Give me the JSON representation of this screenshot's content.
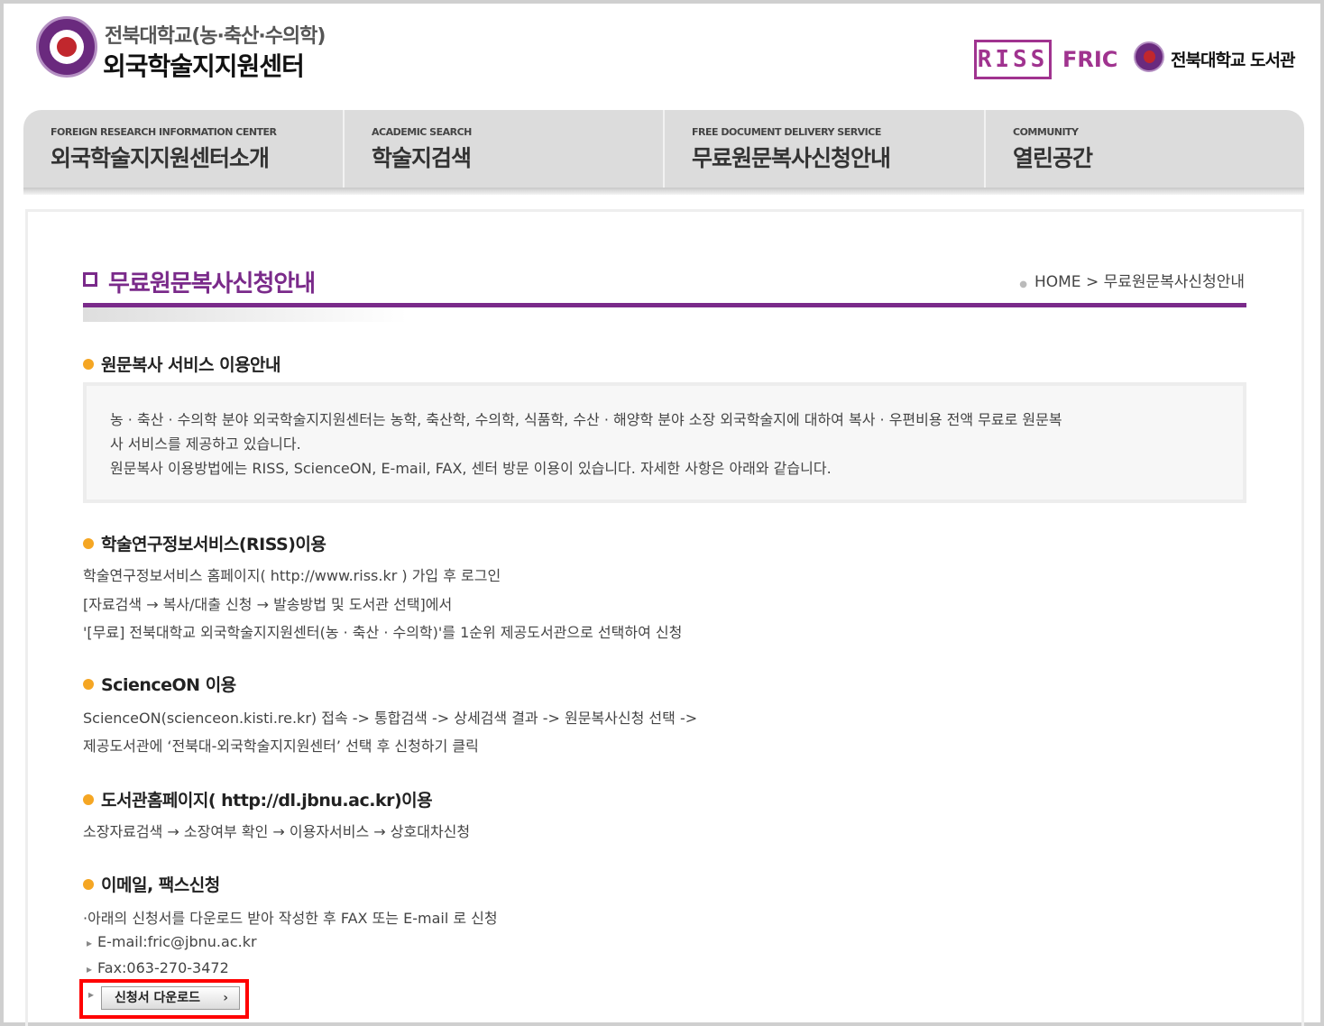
{
  "header": {
    "subtitle": "전북대학교(농·축산·수의학)",
    "title": "외국학술지지원센터",
    "riss_logo": "RISS",
    "fric": "FRIC",
    "library": "전북대학교 도서관"
  },
  "nav": [
    {
      "en": "FOREIGN RESEARCH INFORMATION CENTER",
      "ko": "외국학술지지원센터소개"
    },
    {
      "en": "ACADEMIC SEARCH",
      "ko": "학술지검색"
    },
    {
      "en": "FREE DOCUMENT DELIVERY SERVICE",
      "ko": "무료원문복사신청안내"
    },
    {
      "en": "COMMUNITY",
      "ko": "열린공간"
    }
  ],
  "page": {
    "title": "무료원문복사신청안내",
    "breadcrumb_home": "HOME",
    "breadcrumb_sep": ">",
    "breadcrumb_current": "무료원문복사신청안내"
  },
  "sections": {
    "intro": {
      "title": "원문복사 서비스 이용안내",
      "line1": "농 · 축산 · 수의학 분야 외국학술지지원센터는 농학, 축산학, 수의학, 식품학, 수산 · 해양학 분야 소장 외국학술지에 대하여 복사 · 우편비용 전액 무료로 원문복",
      "line2": "사 서비스를 제공하고 있습니다.",
      "line3": "원문복사 이용방법에는 RISS, ScienceON, E-mail, FAX, 센터 방문 이용이 있습니다. 자세한 사항은 아래와 같습니다."
    },
    "riss": {
      "title": "학술연구정보서비스(RISS)이용",
      "line1": "학술연구정보서비스 홈페이지( http://www.riss.kr ) 가입 후 로그인",
      "line2": "[자료검색 → 복사/대출 신청 → 발송방법 및 도서관 선택]에서",
      "line3": "'[무료] 전북대학교 외국학술지지원센터(농 · 축산 · 수의학)'를 1순위 제공도서관으로 선택하여 신청"
    },
    "scienceon": {
      "title": "ScienceON 이용",
      "line1": "ScienceON(scienceon.kisti.re.kr) 접속 -> 통합검색 -> 상세검색 결과 -> 원문복사신청 선택 ->",
      "line2": "제공도서관에 ‘전북대-외국학술지지원센터’ 선택 후 신청하기 클릭"
    },
    "library": {
      "title": "도서관홈페이지( http://dl.jbnu.ac.kr)이용",
      "line1": "소장자료검색 → 소장여부 확인 → 이용자서비스 → 상호대차신청"
    },
    "email": {
      "title": "이메일, 팩스신청",
      "line1": "·아래의 신청서를 다운로드 받아 작성한 후 FAX 또는 E-mail 로 신청",
      "email": "E-mail:fric@jbnu.ac.kr",
      "fax": "Fax:063-270-3472",
      "download_button": "신청서 다운로드"
    }
  },
  "colors": {
    "accent_purple": "#7a2a8a",
    "bullet_orange": "#f5a623",
    "highlight_red": "#ff0000"
  }
}
